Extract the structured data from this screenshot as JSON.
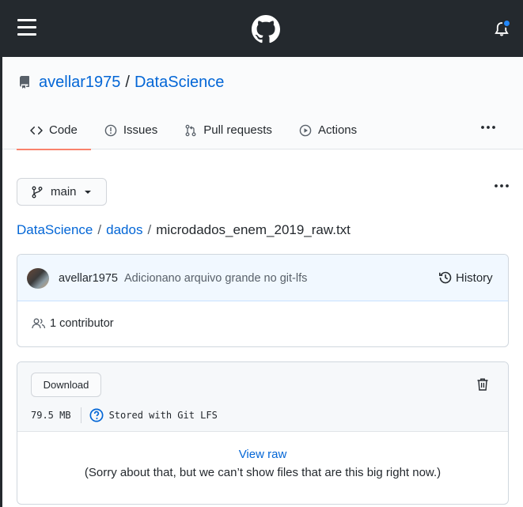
{
  "header": {
    "menu_icon": "hamburger-icon",
    "logo_icon": "github-octocat-icon",
    "notification_icon": "bell-icon",
    "notification_dot_color": "#2188ff"
  },
  "repo": {
    "owner": "avellar1975",
    "separator": "/",
    "name": "DataScience"
  },
  "nav": {
    "tabs": [
      {
        "label": "Code",
        "icon": "code-icon",
        "selected": true
      },
      {
        "label": "Issues",
        "icon": "issue-icon",
        "selected": false
      },
      {
        "label": "Pull requests",
        "icon": "pull-request-icon",
        "selected": false
      },
      {
        "label": "Actions",
        "icon": "play-icon",
        "selected": false
      }
    ],
    "more_icon": "kebab-icon",
    "selected_underline_color": "#f9826c"
  },
  "branch": {
    "label": "main"
  },
  "breadcrumb": {
    "root": "DataScience",
    "folder": "dados",
    "file": "microdados_enem_2019_raw.txt",
    "separator": "/"
  },
  "commit": {
    "author": "avellar1975",
    "message": "Adicionano arquivo grande no git-lfs",
    "history_label": "History",
    "contributors_label": "1 contributor"
  },
  "file": {
    "download_label": "Download",
    "size": "79.5 MB",
    "lfs_label": "Stored with Git LFS",
    "view_raw_label": "View raw",
    "too_big_message": "(Sorry about that, but we can’t show files that are this big right now.)"
  },
  "colors": {
    "header_bg": "#24292e",
    "link": "#0366d6",
    "commit_bg": "#f1f8ff"
  }
}
